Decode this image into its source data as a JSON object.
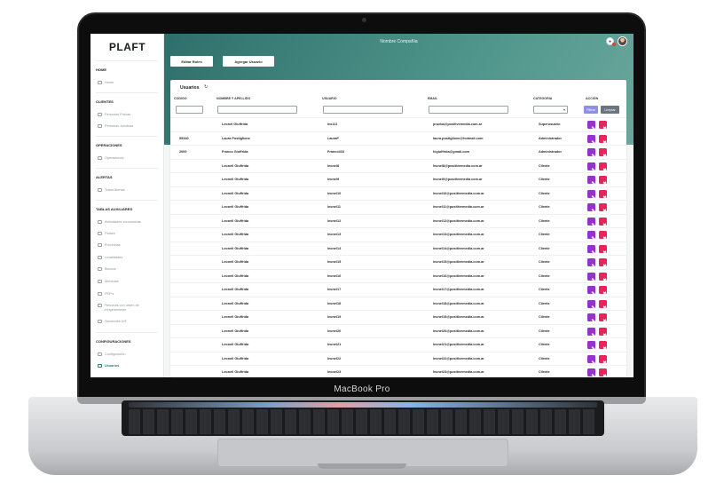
{
  "device_label": "MacBook Pro",
  "app": {
    "logo": "PLAFT",
    "company": "Nombre Compañía",
    "notifications_badge": "1"
  },
  "sidebar": {
    "sections": [
      {
        "title": "HOME",
        "items": [
          {
            "label": "Home",
            "icon": "home-icon"
          }
        ]
      },
      {
        "title": "CLIENTES",
        "items": [
          {
            "label": "Personas Físicas",
            "icon": "document-icon"
          },
          {
            "label": "Personas Jurídicas",
            "icon": "building-icon"
          }
        ]
      },
      {
        "title": "OPERACIONES",
        "items": [
          {
            "label": "Operaciones",
            "icon": "transfer-icon"
          }
        ]
      },
      {
        "title": "ALERTAS",
        "items": [
          {
            "label": "Tratar Alertas",
            "icon": "bell-icon"
          }
        ]
      },
      {
        "title": "TABLAS AUXILIARES",
        "items": [
          {
            "label": "Actividades económicas",
            "icon": "list-icon"
          },
          {
            "label": "Países",
            "icon": "list-icon"
          },
          {
            "label": "Provincias",
            "icon": "list-icon"
          },
          {
            "label": "Localidades",
            "icon": "list-icon"
          },
          {
            "label": "Bancos",
            "icon": "list-icon"
          },
          {
            "label": "Monedas",
            "icon": "list-icon"
          },
          {
            "label": "PEP's",
            "icon": "list-icon"
          },
          {
            "label": "Personas con orden de congelamiento",
            "icon": "list-icon"
          },
          {
            "label": "Sanciones UIF",
            "icon": "list-icon"
          }
        ]
      },
      {
        "title": "CONFIGURACIONES",
        "items": [
          {
            "label": "Configuración",
            "icon": "gear-icon"
          },
          {
            "label": "Usuarios",
            "icon": "users-icon",
            "active": true
          }
        ]
      }
    ]
  },
  "toolbar": {
    "edit_roles": "Editar Roles",
    "add_user": "Agregar Usuario"
  },
  "table": {
    "title": "Usuarios",
    "columns": [
      "CODIGO",
      "NOMBRE Y APELLIDO",
      "USUARIO",
      "EMAIL",
      "CATEGORIA",
      "ACCIÓN"
    ],
    "filter_button": "Filtrar",
    "clear_button": "Limpiar",
    "rows": [
      {
        "codigo": "",
        "nombre": "Leonel Giuffrida",
        "usuario": "leo111",
        "email": "prueba@positivemedia.com.ar",
        "categoria": "Superusuario"
      },
      {
        "codigo": "55340",
        "nombre": "Laura Postiglione",
        "usuario": "LauraP",
        "email": "laura.postiglione@hotmail.com",
        "categoria": "Administrador"
      },
      {
        "codigo": "2000",
        "nombre": "Franco Giuffrida",
        "usuario": "Franco333",
        "email": "fcgiuffrida@gmail.com",
        "categoria": "Administrador"
      },
      {
        "codigo": "",
        "nombre": "Leonell Giuffrida",
        "usuario": "leonel8",
        "email": "leonel8@positivemedia.com.ar",
        "categoria": "Cliente"
      },
      {
        "codigo": "",
        "nombre": "Leonell Giuffrida",
        "usuario": "leonel9",
        "email": "leonel9@positivemedia.com.ar",
        "categoria": "Cliente"
      },
      {
        "codigo": "",
        "nombre": "Leonell Giuffrida",
        "usuario": "leonel10",
        "email": "leonel10@positivemedia.com.ar",
        "categoria": "Cliente"
      },
      {
        "codigo": "",
        "nombre": "Leonell Giuffrida",
        "usuario": "leonel11",
        "email": "leonel11@positivemedia.com.ar",
        "categoria": "Cliente"
      },
      {
        "codigo": "",
        "nombre": "Leonell Giuffrida",
        "usuario": "leonel12",
        "email": "leonel12@positivemedia.com.ar",
        "categoria": "Cliente"
      },
      {
        "codigo": "",
        "nombre": "Leonell Giuffrida",
        "usuario": "leonel13",
        "email": "leonel13@positivemedia.com.ar",
        "categoria": "Cliente"
      },
      {
        "codigo": "",
        "nombre": "Leonell Giuffrida",
        "usuario": "leonel14",
        "email": "leonel14@positivemedia.com.ar",
        "categoria": "Cliente"
      },
      {
        "codigo": "",
        "nombre": "Leonell Giuffrida",
        "usuario": "leonel15",
        "email": "leonel15@positivemedia.com.ar",
        "categoria": "Cliente"
      },
      {
        "codigo": "",
        "nombre": "Leonell Giuffrida",
        "usuario": "leonel16",
        "email": "leonel16@positivemedia.com.ar",
        "categoria": "Cliente"
      },
      {
        "codigo": "",
        "nombre": "Leonell Giuffrida",
        "usuario": "leonel17",
        "email": "leonel17@positivemedia.com.ar",
        "categoria": "Cliente"
      },
      {
        "codigo": "",
        "nombre": "Leonell Giuffrida",
        "usuario": "leonel18",
        "email": "leonel18@positivemedia.com.ar",
        "categoria": "Cliente"
      },
      {
        "codigo": "",
        "nombre": "Leonell Giuffrida",
        "usuario": "leonel19",
        "email": "leonel19@positivemedia.com.ar",
        "categoria": "Cliente"
      },
      {
        "codigo": "",
        "nombre": "Leonell Giuffrida",
        "usuario": "leonel20",
        "email": "leonel20@positivemedia.com.ar",
        "categoria": "Cliente"
      },
      {
        "codigo": "",
        "nombre": "Leonell Giuffrida",
        "usuario": "leonel21",
        "email": "leonel21@positivemedia.com.ar",
        "categoria": "Cliente"
      },
      {
        "codigo": "",
        "nombre": "Leonell Giuffrida",
        "usuario": "leonel22",
        "email": "leonel22@positivemedia.com.ar",
        "categoria": "Cliente"
      },
      {
        "codigo": "",
        "nombre": "Leonell Giuffrida",
        "usuario": "leonel23",
        "email": "leonel23@positivemedia.com.ar",
        "categoria": "Cliente"
      }
    ]
  },
  "colors": {
    "header": "#4f958b",
    "accent": "#2f7a6e",
    "edit": "#9333c9",
    "delete": "#e8245a",
    "filter": "#8f8fe8",
    "clear": "#6c757d"
  }
}
